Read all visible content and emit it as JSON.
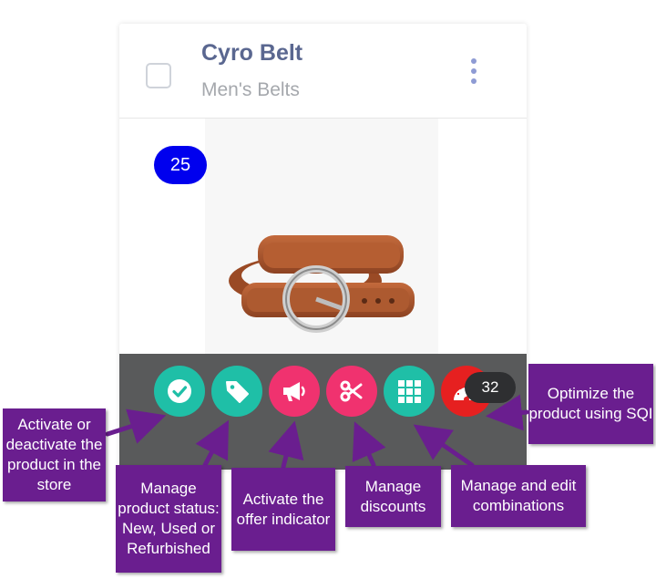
{
  "product": {
    "name": "Cyro Belt",
    "category": "Men's Belts",
    "image_badge": "25",
    "sqi_count": "32"
  },
  "actions": [
    {
      "name": "activate",
      "icon": "check-circle-icon",
      "color": "#1fbfa7"
    },
    {
      "name": "status",
      "icon": "tag-icon",
      "color": "#1fbfa7"
    },
    {
      "name": "offer",
      "icon": "megaphone-icon",
      "color": "#f0326f"
    },
    {
      "name": "discounts",
      "icon": "scissors-icon",
      "color": "#f0326f"
    },
    {
      "name": "combinations",
      "icon": "grid-icon",
      "color": "#1fbfa7"
    },
    {
      "name": "sqi",
      "icon": "speedometer-icon",
      "color": "#e62020"
    }
  ],
  "callouts": {
    "activate": "Activate or deactivate the product in the store",
    "status": "Manage product status: New, Used or Refurbished",
    "offer": "Activate the offer indicator",
    "discounts": "Manage discounts",
    "combinations": "Manage and edit combinations",
    "sqi": "Optimize the product using SQI"
  },
  "colors": {
    "callout_bg": "#6a1e8f",
    "title": "#5a6790",
    "badge": "#0000ee"
  }
}
